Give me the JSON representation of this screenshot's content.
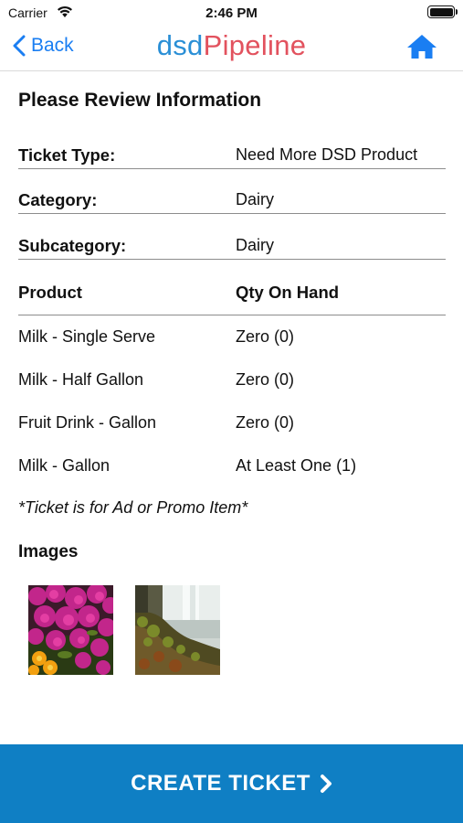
{
  "status_bar": {
    "carrier": "Carrier",
    "time": "2:46 PM"
  },
  "nav": {
    "back_label": "Back",
    "logo_part1": "dsd",
    "logo_part2": "Pipeline",
    "accent_color": "#1a7ef2"
  },
  "review": {
    "title": "Please Review Information",
    "ticket_type_label": "Ticket Type:",
    "ticket_type_value": "Need More DSD Product",
    "category_label": "Category:",
    "category_value": "Dairy",
    "subcategory_label": "Subcategory:",
    "subcategory_value": "Dairy"
  },
  "products": {
    "col_product": "Product",
    "col_qty": "Qty On Hand",
    "rows": [
      {
        "product": "Milk - Single Serve",
        "qty": "Zero (0)"
      },
      {
        "product": "Milk - Half Gallon",
        "qty": "Zero (0)"
      },
      {
        "product": "Fruit Drink - Gallon",
        "qty": "Zero (0)"
      },
      {
        "product": "Milk - Gallon",
        "qty": "At Least One (1)"
      }
    ]
  },
  "promo_note": "*Ticket is for Ad or Promo Item*",
  "images": {
    "heading": "Images",
    "items": [
      {
        "subject": "flowers-photo"
      },
      {
        "subject": "waterfall-photo"
      }
    ]
  },
  "cta": {
    "label": "CREATE TICKET",
    "color": "#0f7fc4"
  }
}
